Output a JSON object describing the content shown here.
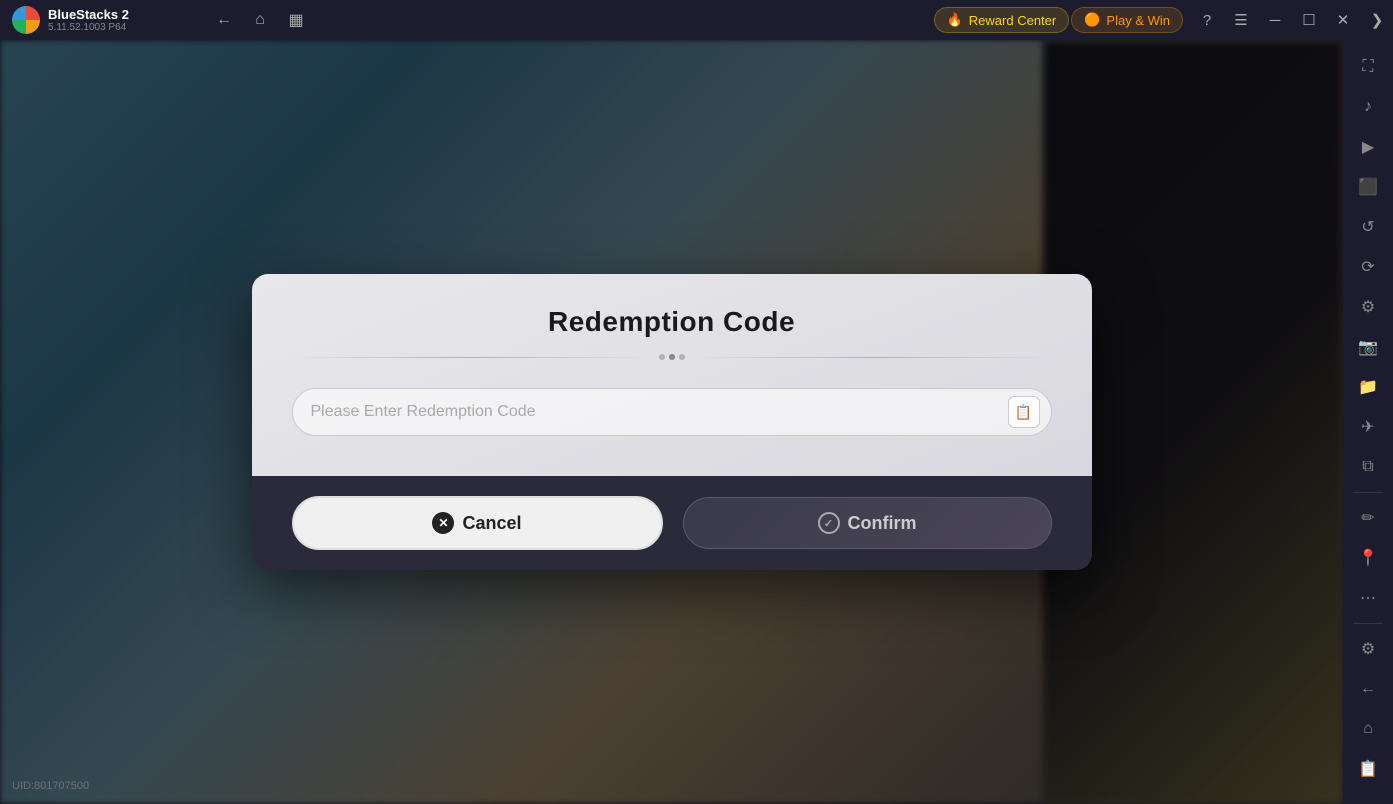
{
  "topbar": {
    "app_name": "BlueStacks 2",
    "app_version": "5.11.52.1003  P64",
    "reward_center_label": "Reward Center",
    "play_win_label": "Play & Win"
  },
  "modal": {
    "title": "Redemption Code",
    "input_placeholder": "Please Enter Redemption Code",
    "cancel_label": "Cancel",
    "confirm_label": "Confirm"
  },
  "uid": {
    "label": "UID:801707500"
  },
  "sidebar": {
    "icons": [
      "⛶",
      "♪",
      "▶",
      "⬛",
      "↺",
      "⟳",
      "⚙",
      "📷",
      "📁",
      "✈",
      "⧉",
      "✏",
      "📍",
      "⋯",
      "⚙",
      "←",
      "⌂",
      "📋"
    ]
  }
}
